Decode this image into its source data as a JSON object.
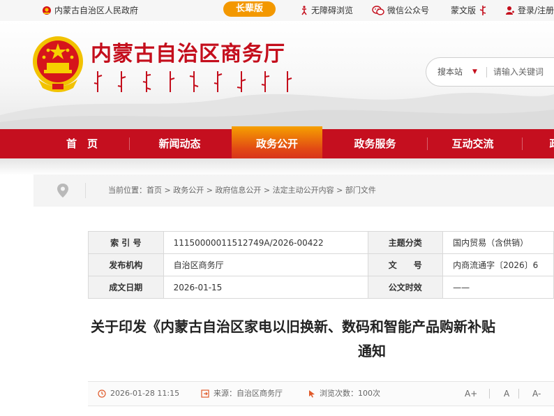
{
  "topbar": {
    "gov_link": "内蒙古自治区人民政府",
    "elder_mode": "长辈版",
    "accessibility": "无障碍浏览",
    "wechat": "微信公众号",
    "mongol_version": "蒙文版",
    "login": "登录/注册"
  },
  "header": {
    "title": "内蒙古自治区商务厅",
    "search_scope": "搜本站",
    "search_placeholder": "请输入关键词"
  },
  "nav": [
    {
      "label": "首　页"
    },
    {
      "label": "新闻动态"
    },
    {
      "label": "政务公开"
    },
    {
      "label": "政务服务"
    },
    {
      "label": "互动交流"
    },
    {
      "label": "政"
    }
  ],
  "breadcrumb": {
    "prefix": "当前位置：",
    "items": [
      "首页",
      "政务公开",
      "政府信息公开",
      "法定主动公开内容",
      "部门文件"
    ]
  },
  "info": {
    "index_label": "索 引 号",
    "index_value": "11150000011512749A/2026-00422",
    "topic_label": "主题分类",
    "topic_value": "国内贸易（含供销）",
    "publisher_label": "发布机构",
    "publisher_value": "自治区商务厅",
    "docno_label": "文　　号",
    "docno_value": "内商流通字〔2026〕6",
    "date_label": "成文日期",
    "date_value": "2026-01-15",
    "public_label": "公文时效",
    "public_value": "——"
  },
  "article": {
    "title_line1": "关于印发《内蒙古自治区家电以旧换新、数码和智能产品购新补贴",
    "title_line2": "通知"
  },
  "meta": {
    "time": "2026-01-28 11:15",
    "source": "来源：自治区商务厅",
    "views": "浏览次数：100次",
    "font_large": "A+",
    "font_mid": "A",
    "font_small": "A-"
  },
  "colors": {
    "brand_red": "#c50f1f",
    "accent_orange": "#f39800"
  }
}
